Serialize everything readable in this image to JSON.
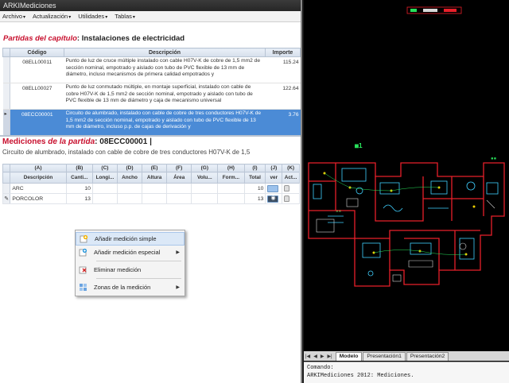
{
  "app": {
    "title": "ARKIMediciones"
  },
  "menubar": {
    "items": [
      {
        "label": "Archivo"
      },
      {
        "label": "Actualización"
      },
      {
        "label": "Utilidades"
      },
      {
        "label": "Tablas"
      }
    ]
  },
  "partidas": {
    "title_prefix": "Partidas del capítulo",
    "title_colon": ":",
    "title_rest": "Instalaciones de electricidad",
    "headers": {
      "codigo": "Código",
      "descripcion": "Descripción",
      "importe": "Importe"
    },
    "rows": [
      {
        "code": "08ELL00011",
        "description": "Punto de luz de cruce múltiple instalado con cable H07V-K de cobre de 1,5 mm2 de sección nominal, empotrado y aislado con tubo de PVC flexible de 13 mm de diámetro, incluso mecanismos de primera calidad empotrados y",
        "amount": "115.24",
        "selected": false
      },
      {
        "code": "08ELL00027",
        "description": "Punto de luz conmutado múltiple, en montaje superficial, instalado con cable de cobre H07V-K de 1,5 mm2 de sección nominal, empotrado y aislado con tubo de PVC flexible de 13 mm de diámetro y caja de mecanismo universal",
        "amount": "122.64",
        "selected": false
      },
      {
        "code": "08ECC00001",
        "description": "Circuito de alumbrado, instalado con cable de cobre de tres conductores H07V-K de 1,5 mm2 de sección nominal, empotrado y aislado con tubo de PVC flexible de 13 mm de diámetro, incluso p.p. de cajas de derivación y",
        "amount": "3.76",
        "selected": true
      }
    ]
  },
  "mediciones": {
    "label1": "Mediciones",
    "label2": "de la partida",
    "code": ": 08ECC00001 |",
    "description": "Circuito de alumbrado, instalado con cable de cobre de tres conductores H07V-K de 1,5",
    "letters": [
      "(A)",
      "(B)",
      "(C)",
      "(D)",
      "(E)",
      "(F)",
      "(G)",
      "(H)",
      "(I)",
      "(J)",
      "(K)"
    ],
    "columns": [
      "Descripción",
      "Canti...",
      "Longi...",
      "Ancho",
      "Altura",
      "Área",
      "Volu...",
      "Form...",
      "Total",
      "ver",
      "Act..."
    ],
    "rows": [
      {
        "marker": "",
        "desc": "ARC",
        "qty": "10",
        "total": "10",
        "ver_active": false
      },
      {
        "marker": "✎",
        "desc": "PORCOLOR",
        "qty": "13",
        "total": "13",
        "ver_active": true
      }
    ]
  },
  "context_menu": {
    "items": [
      {
        "label": "Añadir medición simple",
        "icon": "add-simple-icon",
        "submenu": false,
        "hover": true
      },
      {
        "label": "Añadir medición especial",
        "icon": "add-special-icon",
        "submenu": true,
        "hover": false
      },
      {
        "label": "Eliminar medición",
        "icon": "delete-icon",
        "submenu": false,
        "hover": false
      },
      {
        "label": "Zonas de la medición",
        "icon": "zones-icon",
        "submenu": true,
        "hover": false
      }
    ]
  },
  "cad": {
    "tabs": [
      {
        "label": "Modelo",
        "active": true
      },
      {
        "label": "Presentación1",
        "active": false
      },
      {
        "label": "Presentación2",
        "active": false
      }
    ],
    "console": {
      "line1": "Comando:",
      "line2": "ARKIMediciones 2012: Mediciones."
    },
    "colors": {
      "walls": "#e8202a",
      "fixtures": "#3fd0ff",
      "accent": "#28e05a",
      "furniture": "#d8d8d8"
    }
  }
}
